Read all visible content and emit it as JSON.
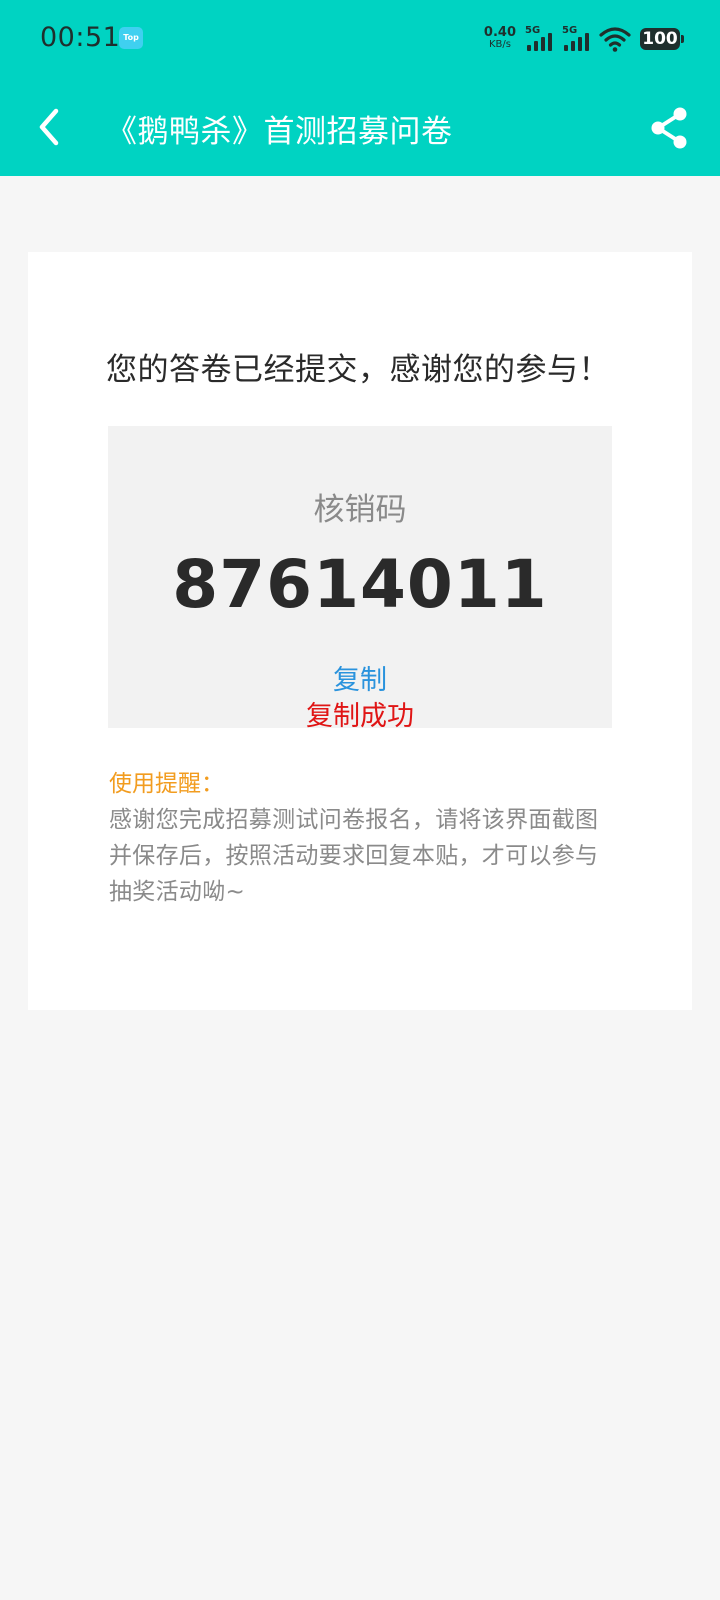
{
  "status_bar": {
    "time": "00:51",
    "app_icon_text": "Top",
    "net_speed_value": "0.40",
    "net_speed_unit": "KB/s",
    "signal_1_label": "5G",
    "signal_2_label": "5G",
    "battery": "100"
  },
  "header": {
    "title": "《鹅鸭杀》首测招募问卷",
    "accent_color": "#00d3c2"
  },
  "result": {
    "success_message": "您的答卷已经提交，感谢您的参与！",
    "code_label": "核销码",
    "code_value": "87614011",
    "copy_label": "复制",
    "copy_status": "复制成功"
  },
  "reminder": {
    "title": "使用提醒：",
    "body": "感谢您完成招募测试问卷报名，请将该界面截图并保存后，按照活动要求回复本贴，才可以参与抽奖活动呦~"
  }
}
